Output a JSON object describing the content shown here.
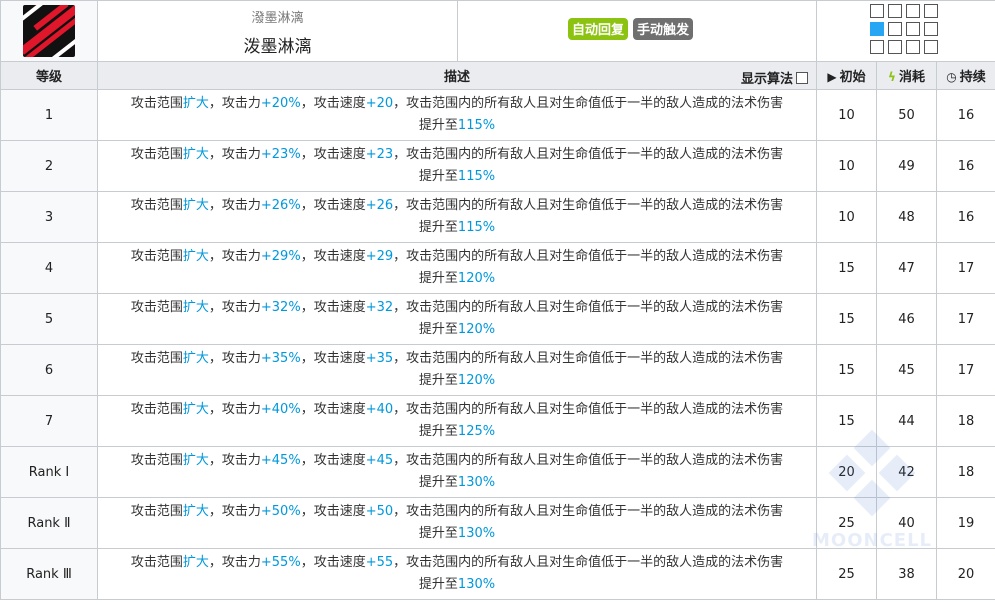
{
  "skill": {
    "subname": "潑墨淋漓",
    "name": "泼墨淋漓",
    "badges": [
      {
        "label": "自动回复",
        "color": "#8cc311"
      },
      {
        "label": "手动触发",
        "color": "#6f6f6f"
      }
    ]
  },
  "columns": {
    "level": "等级",
    "desc": "描述",
    "algo": "显示算法",
    "initial": "初始",
    "cost": "消耗",
    "duration": "持续"
  },
  "rows": [
    {
      "level": "1",
      "atk": "+20%",
      "spd": "+20",
      "dmg": "115%",
      "initial": "10",
      "cost": "50",
      "duration": "16"
    },
    {
      "level": "2",
      "atk": "+23%",
      "spd": "+23",
      "dmg": "115%",
      "initial": "10",
      "cost": "49",
      "duration": "16"
    },
    {
      "level": "3",
      "atk": "+26%",
      "spd": "+26",
      "dmg": "115%",
      "initial": "10",
      "cost": "48",
      "duration": "16"
    },
    {
      "level": "4",
      "atk": "+29%",
      "spd": "+29",
      "dmg": "120%",
      "initial": "15",
      "cost": "47",
      "duration": "17"
    },
    {
      "level": "5",
      "atk": "+32%",
      "spd": "+32",
      "dmg": "120%",
      "initial": "15",
      "cost": "46",
      "duration": "17"
    },
    {
      "level": "6",
      "atk": "+35%",
      "spd": "+35",
      "dmg": "120%",
      "initial": "15",
      "cost": "45",
      "duration": "17"
    },
    {
      "level": "7",
      "atk": "+40%",
      "spd": "+40",
      "dmg": "125%",
      "initial": "15",
      "cost": "44",
      "duration": "18"
    },
    {
      "level": "Rank Ⅰ",
      "atk": "+45%",
      "spd": "+45",
      "dmg": "130%",
      "initial": "20",
      "cost": "42",
      "duration": "18"
    },
    {
      "level": "Rank Ⅱ",
      "atk": "+50%",
      "spd": "+50",
      "dmg": "130%",
      "initial": "25",
      "cost": "40",
      "duration": "19"
    },
    {
      "level": "Rank Ⅲ",
      "atk": "+55%",
      "spd": "+55",
      "dmg": "130%",
      "initial": "25",
      "cost": "38",
      "duration": "20"
    }
  ],
  "desc_parts": {
    "p1": "攻击范围",
    "expand": "扩大",
    "p2": "，攻击力",
    "p3": "，攻击速度",
    "p4": "，攻击范围内的所有敌人且对生命值低于一半的敌人造成的法术伤害",
    "p5": "提升至"
  },
  "icons": {
    "initial": "play-icon",
    "cost": "lightning-icon",
    "duration": "clock-icon"
  },
  "colors": {
    "highlight": "#0098dc",
    "range_blue": "#27a6f3"
  },
  "watermark": "MOONCELL"
}
